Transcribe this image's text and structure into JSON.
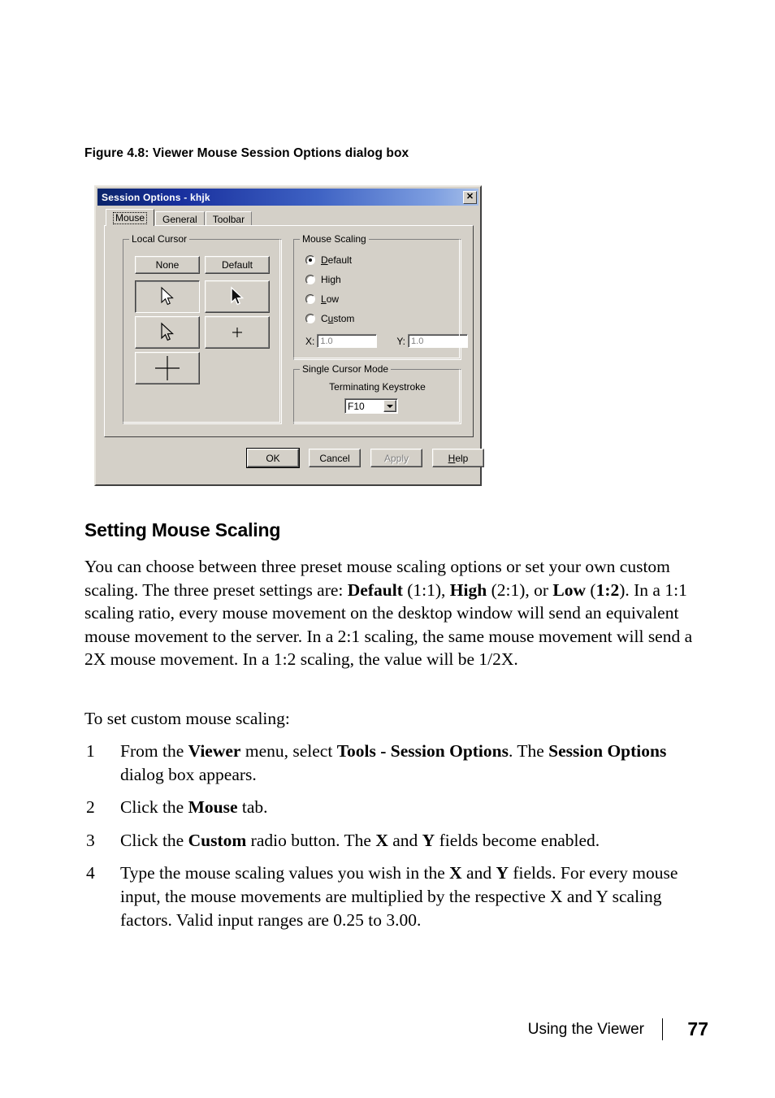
{
  "figure": {
    "caption": "Figure 4.8: Viewer Mouse Session Options dialog box",
    "dialog": {
      "title": "Session Options - khjk",
      "close_label": "✕",
      "tabs": [
        {
          "label": "Mouse",
          "active": true
        },
        {
          "label": "General",
          "active": false
        },
        {
          "label": "Toolbar",
          "active": false
        }
      ],
      "local_cursor": {
        "legend": "Local Cursor",
        "none_label": "None",
        "default_label": "Default",
        "cursor_icons": [
          "cursor-arrow-white-icon",
          "cursor-arrow-black-icon",
          "cursor-arrow-outline-icon",
          "cursor-small-crosshair-icon",
          "cursor-large-crosshair-icon"
        ]
      },
      "mouse_scaling": {
        "legend": "Mouse Scaling",
        "options": [
          {
            "label": "Default",
            "mnemonic": "D",
            "selected": true
          },
          {
            "label": "High",
            "mnemonic": "g",
            "selected": false
          },
          {
            "label": "Low",
            "mnemonic": "L",
            "selected": false
          },
          {
            "label": "Custom",
            "mnemonic": "u",
            "selected": false
          }
        ],
        "x_label": "X:",
        "x_value": "1.0",
        "y_label": "Y:",
        "y_value": "1.0"
      },
      "single_cursor": {
        "legend": "Single Cursor Mode",
        "keystroke_label": "Terminating Keystroke",
        "keystroke_value": "F10"
      },
      "buttons": [
        {
          "label": "OK",
          "state": "default"
        },
        {
          "label": "Cancel",
          "state": "normal"
        },
        {
          "label": "Apply",
          "state": "disabled"
        },
        {
          "label": "Help",
          "state": "normal"
        }
      ]
    }
  },
  "content": {
    "heading": "Setting Mouse Scaling",
    "paragraph_1": "You can choose between three preset mouse scaling options or set your own custom scaling. The three preset settings are: Default (1:1), High (2:1), or Low (1:2). In a 1:1 scaling ratio, every mouse movement on the desktop window will send an equivalent mouse movement to the server. In a 2:1 scaling, the same mouse movement will send a 2X mouse movement. In a 1:2 scaling, the value will be 1/2X.",
    "paragraph_2": "To set custom mouse scaling:",
    "steps": [
      {
        "number": "1",
        "text": "From the Viewer menu, select Tools - Session Options. The Session Options dialog box appears."
      },
      {
        "number": "2",
        "text": "Click the Mouse tab."
      },
      {
        "number": "3",
        "text": "Click the Custom radio button. The X and Y fields become enabled."
      },
      {
        "number": "4",
        "text": "Type the mouse scaling values you wish in the X and Y fields. For every mouse input, the mouse movements are multiplied by the respective X and Y scaling factors. Valid input ranges are 0.25 to 3.00."
      }
    ]
  },
  "footer": {
    "label": "Using the Viewer",
    "page_number": "77"
  }
}
